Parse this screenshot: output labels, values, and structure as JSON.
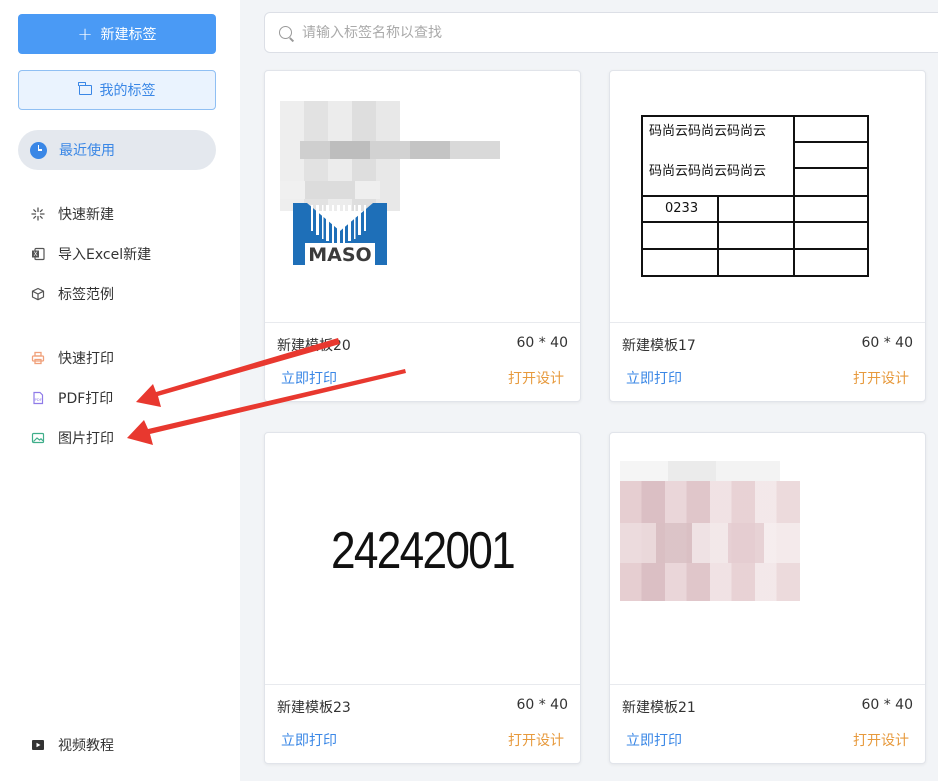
{
  "sidebar": {
    "new_label": "新建标签",
    "mine_label": "我的标签",
    "recent_label": "最近使用",
    "items": [
      {
        "label": "快速新建",
        "icon": "sparkle-icon"
      },
      {
        "label": "导入Excel新建",
        "icon": "excel-icon"
      },
      {
        "label": "标签范例",
        "icon": "cube-icon"
      },
      {
        "label": "快速打印",
        "icon": "printer-icon"
      },
      {
        "label": "PDF打印",
        "icon": "pdf-icon"
      },
      {
        "label": "图片打印",
        "icon": "image-icon"
      },
      {
        "label": "视频教程",
        "icon": "video-icon"
      }
    ]
  },
  "search": {
    "placeholder": "请输入标签名称以查找",
    "value": ""
  },
  "cards": [
    {
      "name": "新建模板20",
      "size": "60 * 40",
      "print": "立即打印",
      "design": "打开设计",
      "preview_text": "MASO"
    },
    {
      "name": "新建模板17",
      "size": "60 * 40",
      "print": "立即打印",
      "design": "打开设计",
      "table": {
        "row1": "码尚云码尚云码尚云",
        "row2": "码尚云码尚云码尚云",
        "code": "0233"
      }
    },
    {
      "name": "新建模板23",
      "size": "60 * 40",
      "print": "立即打印",
      "design": "打开设计",
      "preview_text": "24242001"
    },
    {
      "name": "新建模板21",
      "size": "60 * 40",
      "print": "立即打印",
      "design": "打开设计"
    }
  ],
  "colors": {
    "accent": "#4a9af5",
    "link": "#3a87e6",
    "design": "#e79a3d",
    "arrow": "#e8382f"
  }
}
